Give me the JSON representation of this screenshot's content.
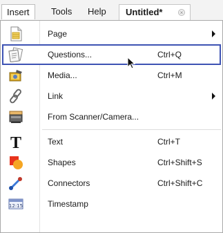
{
  "menubar": {
    "items": [
      {
        "label": "Insert"
      },
      {
        "label": "Tools"
      },
      {
        "label": "Help"
      }
    ],
    "doc_tab": {
      "title": "Untitled*",
      "close_icon": "close-icon"
    }
  },
  "menu": {
    "items": [
      {
        "label": "Page",
        "shortcut": "",
        "submenu": true,
        "icon": "page-icon"
      },
      {
        "label": "Questions...",
        "shortcut": "Ctrl+Q",
        "submenu": false,
        "icon": "questions-icon",
        "highlighted": true
      },
      {
        "label": "Media...",
        "shortcut": "Ctrl+M",
        "submenu": false,
        "icon": "media-icon"
      },
      {
        "label": "Link",
        "shortcut": "",
        "submenu": true,
        "icon": "link-icon"
      },
      {
        "label": "From Scanner/Camera...",
        "shortcut": "",
        "submenu": false,
        "icon": "scanner-icon"
      },
      {
        "label": "Text",
        "shortcut": "Ctrl+T",
        "submenu": false,
        "icon": "text-icon"
      },
      {
        "label": "Shapes",
        "shortcut": "Ctrl+Shift+S",
        "submenu": false,
        "icon": "shapes-icon"
      },
      {
        "label": "Connectors",
        "shortcut": "Ctrl+Shift+C",
        "submenu": false,
        "icon": "connector-icon"
      },
      {
        "label": "Timestamp",
        "shortcut": "",
        "submenu": false,
        "icon": "timestamp-icon"
      }
    ],
    "timestamp_icon_text": "12:15"
  },
  "colors": {
    "highlight_border": "#3d52b3",
    "accent_red": "#e8331c",
    "accent_orange": "#f5a623"
  }
}
